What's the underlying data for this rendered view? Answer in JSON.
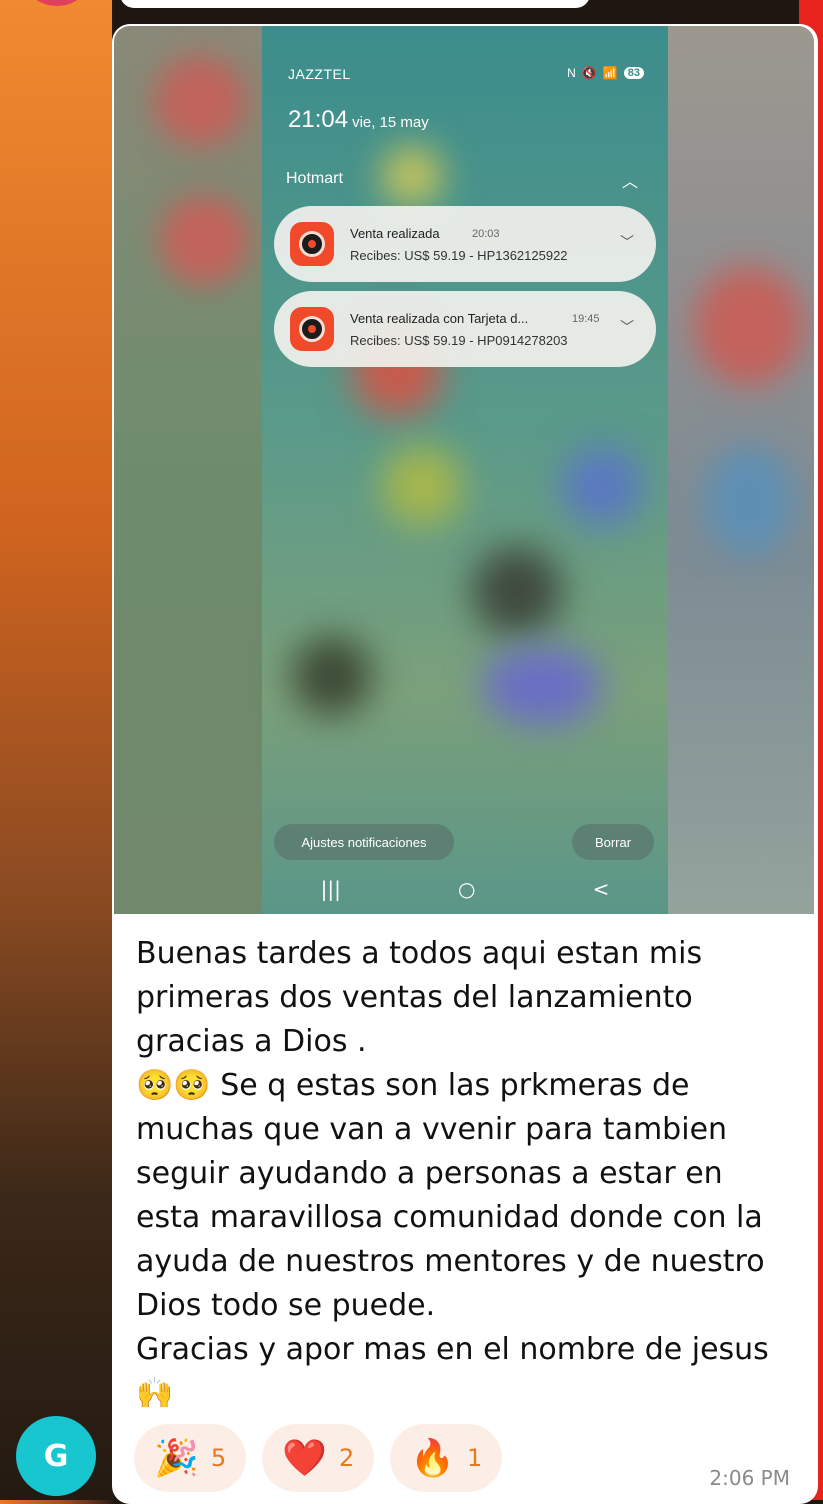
{
  "screenshot": {
    "carrier": "JAZZTEL",
    "battery": "83",
    "time": "21:04",
    "date": "vie, 15 may",
    "notification_group": "Hotmart",
    "notifications": [
      {
        "title": "Venta realizada",
        "time": "20:03",
        "body": "Recibes: US$ 59.19 - HP1362125922"
      },
      {
        "title": "Venta realizada con Tarjeta d...",
        "time": "19:45",
        "body": "Recibes: US$ 59.19 - HP0914278203"
      }
    ],
    "settings_button": "Ajustes notificaciones",
    "clear_button": "Borrar",
    "nav": {
      "recents": "|||",
      "home": "○",
      "back": "<"
    }
  },
  "message": {
    "text": "Buenas tardes a todos aqui estan mis\nprimeras dos ventas del lanzamiento\ngracias a Dios .\n🥺🥺 Se q estas son las prkmeras de\nmuchas que van a vvenir para tambien\nseguir ayudando a personas a estar en\nesta maravillosa comunidad donde con la\nayuda de nuestros mentores y de nuestro\nDios todo se puede.\nGracias y apor mas en el nombre de jesus\n🙌",
    "timestamp": "2:06 PM"
  },
  "reactions": [
    {
      "emoji": "🎉",
      "count": "5"
    },
    {
      "emoji": "❤️",
      "count": "2"
    },
    {
      "emoji": "🔥",
      "count": "1"
    }
  ],
  "sender_avatar": "G",
  "colors": {
    "accent_orange": "#e87a1d",
    "avatar_teal": "#18c6cf",
    "hotmart_red": "#f04a2a"
  }
}
